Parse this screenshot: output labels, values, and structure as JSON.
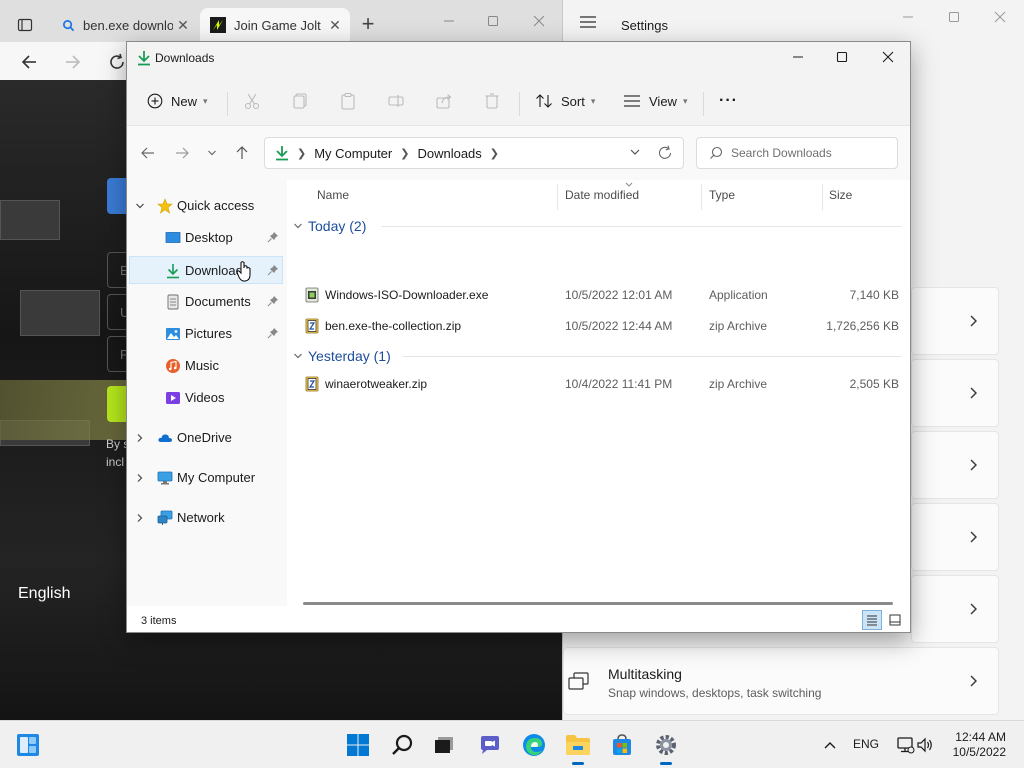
{
  "browser": {
    "tabs": [
      {
        "title": "ben.exe downlo",
        "icon": "search-icon",
        "close": "✕"
      },
      {
        "title": "Join Game Jolt -",
        "icon": "gamejolt-logo-icon",
        "close": "✕"
      }
    ],
    "new_tab": "+",
    "language": "English",
    "login_fragments": {
      "a": "E",
      "b": "U",
      "c": "P",
      "d": "By s",
      "e": "incl"
    }
  },
  "settings": {
    "title": "Settings",
    "multitasking": {
      "title": "Multitasking",
      "subtitle": "Snap windows, desktops, task switching"
    }
  },
  "explorer": {
    "title": "Downloads",
    "toolbar": {
      "new_label": "New",
      "sort_label": "Sort",
      "view_label": "View",
      "more_label": "···"
    },
    "address": {
      "crumbs": [
        "My Computer",
        "Downloads"
      ]
    },
    "search": {
      "placeholder": "Search Downloads"
    },
    "nav": {
      "quick_access": "Quick access",
      "desktop": "Desktop",
      "downloads": "Downloads",
      "documents": "Documents",
      "pictures": "Pictures",
      "music": "Music",
      "videos": "Videos",
      "onedrive": "OneDrive",
      "my_computer": "My Computer",
      "network": "Network"
    },
    "columns": {
      "name": "Name",
      "date": "Date modified",
      "type": "Type",
      "size": "Size"
    },
    "groups": [
      {
        "label": "Today (2)",
        "files": [
          {
            "name": "Windows-ISO-Downloader.exe",
            "date": "10/5/2022 12:01 AM",
            "type": "Application",
            "size": "7,140 KB",
            "icon": "exe-file-icon"
          },
          {
            "name": "ben.exe-the-collection.zip",
            "date": "10/5/2022 12:44 AM",
            "type": "zip Archive",
            "size": "1,726,256 KB",
            "icon": "zip-file-icon"
          }
        ]
      },
      {
        "label": "Yesterday (1)",
        "files": [
          {
            "name": "winaerotweaker.zip",
            "date": "10/4/2022 11:41 PM",
            "type": "zip Archive",
            "size": "2,505 KB",
            "icon": "zip-file-icon"
          }
        ]
      }
    ],
    "status": {
      "count": "3 items"
    }
  },
  "taskbar": {
    "language": "ENG",
    "time": "12:44 AM",
    "date": "10/5/2022"
  },
  "colors": {
    "accent": "#0067c0",
    "group_header": "#1e4e9b",
    "selection": "#e5f1fb",
    "folder_green": "#1a9c55"
  }
}
